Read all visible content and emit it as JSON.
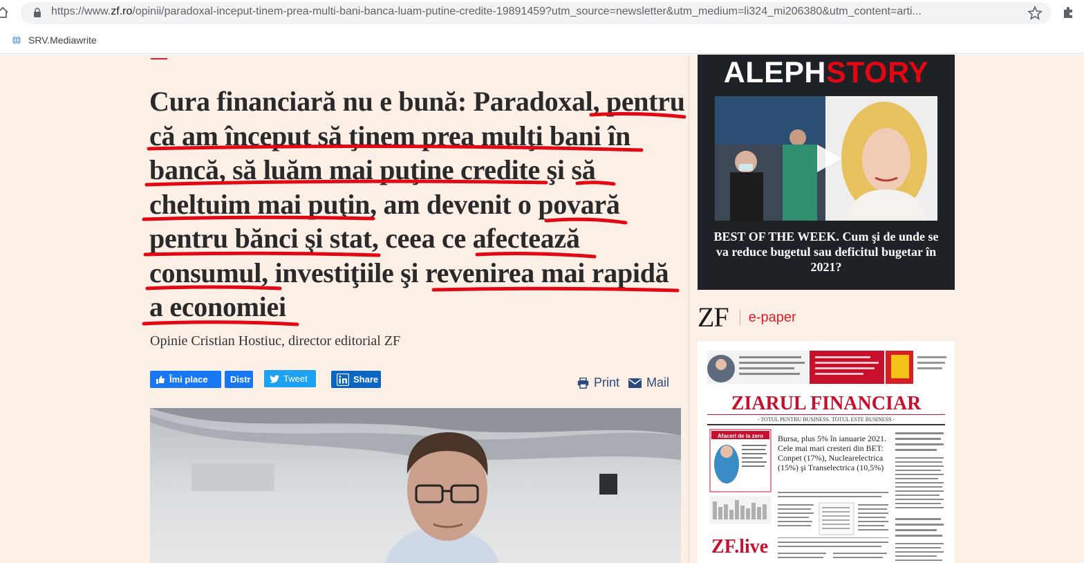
{
  "browser": {
    "url_prefix": "https://www.",
    "url_domain": "zf.ro",
    "url_rest": "/opinii/paradoxal-inceput-tinem-prea-multi-bani-banca-luam-putine-credite-19891459?utm_source=newsletter&utm_medium=li324_mi206380&utm_content=arti...",
    "bookmark": "SRV.Mediawrite"
  },
  "article": {
    "headline_lines": [
      [
        "Cura financiară nu e bună: Paradoxal, ",
        "pentru"
      ],
      [
        "că am început să ţinem prea mulţi bani în",
        ""
      ],
      [
        "bancă, să luăm mai puţine credite",
        " şi ",
        "să"
      ],
      [
        "cheltuim mai puţin",
        ", am devenit o ",
        "povară"
      ],
      [
        "pentru bănci şi stat",
        ", ceea ce ",
        "afectează"
      ],
      [
        "consumul,",
        " investiţiile şi ",
        "revenirea mai rapidă"
      ],
      [
        "a economiei"
      ]
    ],
    "byline": "Opinie Cristian Hostiuc, director editorial ZF"
  },
  "share": {
    "like": "Îmi place",
    "distribute": "Distr",
    "tweet": "Tweet",
    "linkedin": "Share"
  },
  "tools": {
    "print": "Print",
    "mail": "Mail"
  },
  "sidebar": {
    "video_brand_a": "ALEPH",
    "video_brand_b": "STORY",
    "video_caption": "BEST OF THE WEEK. Cum şi de unde se va reduce bugetul sau deficitul bugetar în 2021?",
    "zf_logo": "ZF",
    "epaper": "e-paper",
    "paper_title": "ZIARUL FINANCIAR",
    "paper_tagline": "- TOTUL PENTRU BUSINESS. TOTUL ESTE BUSINESS -",
    "paper_lead": "Bursa, plus 5% în ianuarie 2021. Cele mai mari cresteri din BET: Conpet (17%), Nuclearelectrica (15%) şi Transelectrica (10,5%)",
    "paper_promo": "ZF.live",
    "paper_box": "Afaceri de la zero"
  },
  "colors": {
    "page_bg": "#fcefe6",
    "underline": "#e30613",
    "accent_red": "#d81f26",
    "link_blue": "#2c4a7c"
  }
}
